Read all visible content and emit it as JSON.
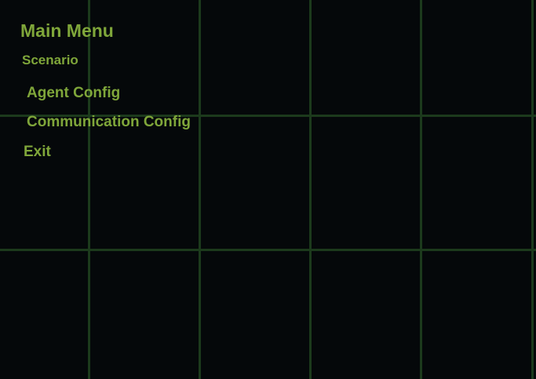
{
  "menu": {
    "title": "Main Menu",
    "section_label": "Scenario",
    "items": [
      {
        "label": "Agent Config"
      },
      {
        "label": "Communication Config"
      }
    ],
    "exit_label": "Exit"
  },
  "colors": {
    "background": "#05080a",
    "grid": "#1c3a1c",
    "text": "#7fa63a"
  }
}
